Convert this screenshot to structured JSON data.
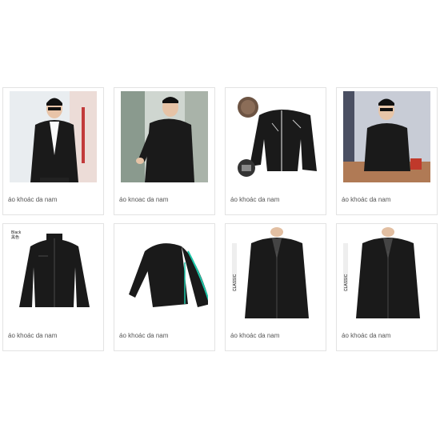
{
  "products": [
    {
      "label": "áo khoác da nam"
    },
    {
      "label": "áo knoac da nam"
    },
    {
      "label": "áo khoác da nam"
    },
    {
      "label": "áo khoác da nam"
    },
    {
      "label": "áo khoác da nam",
      "color_tag": "Black",
      "color_tag_cn": "黑色"
    },
    {
      "label": "áo khoác da nam"
    },
    {
      "label": "áo khoác da nam",
      "side_text": "CLASSIC"
    },
    {
      "label": "áo khoác da nam",
      "side_text": "CLASSIC"
    }
  ],
  "colors": {
    "jacket": "#1a1a1a",
    "border": "#e3e3e3",
    "accent": "#1dc6a8"
  }
}
